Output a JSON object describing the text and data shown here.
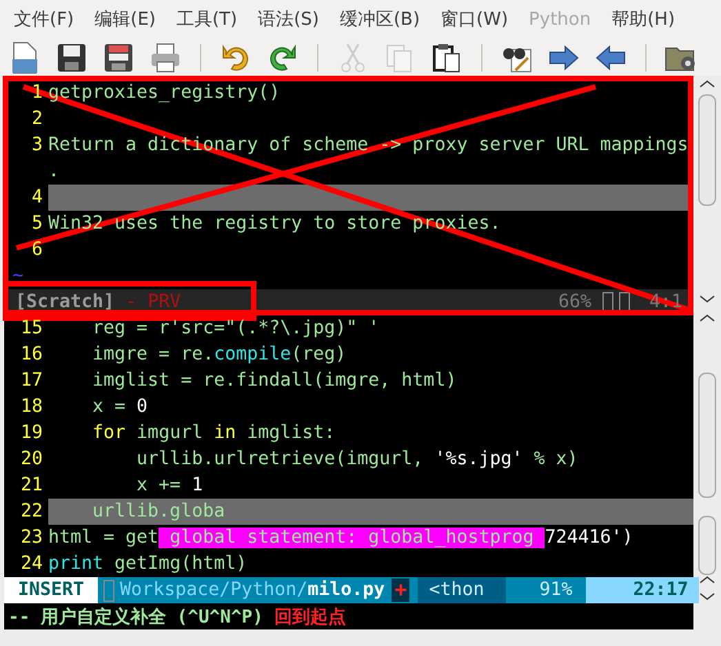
{
  "menu": [
    {
      "label": "文件(F)",
      "disabled": false
    },
    {
      "label": "编辑(E)",
      "disabled": false
    },
    {
      "label": "工具(T)",
      "disabled": false
    },
    {
      "label": "语法(S)",
      "disabled": false
    },
    {
      "label": "缓冲区(B)",
      "disabled": false
    },
    {
      "label": "窗口(W)",
      "disabled": false
    },
    {
      "label": "Python",
      "disabled": true
    },
    {
      "label": "帮助(H)",
      "disabled": false
    }
  ],
  "toolbar": [
    {
      "kind": "new",
      "disabled": false
    },
    {
      "kind": "save",
      "disabled": false
    },
    {
      "kind": "saveall",
      "disabled": false
    },
    {
      "kind": "print",
      "disabled": false
    },
    {
      "kind": "sep"
    },
    {
      "kind": "undo",
      "disabled": false
    },
    {
      "kind": "redo",
      "disabled": false
    },
    {
      "kind": "sep"
    },
    {
      "kind": "cut",
      "disabled": true
    },
    {
      "kind": "copy",
      "disabled": true
    },
    {
      "kind": "paste",
      "disabled": false
    },
    {
      "kind": "sep"
    },
    {
      "kind": "find",
      "disabled": false
    },
    {
      "kind": "forward",
      "disabled": false
    },
    {
      "kind": "back",
      "disabled": false
    },
    {
      "kind": "sep"
    },
    {
      "kind": "folder",
      "disabled": false
    }
  ],
  "preview": {
    "lines": [
      {
        "number": "1",
        "text": "getproxies_registry()",
        "current": false
      },
      {
        "number": "2",
        "current": false
      },
      {
        "number": "3",
        "text": "Return a dictionary of scheme -> proxy server URL mappings",
        "current": false
      },
      {
        "text": ".",
        "current": false
      },
      {
        "number": "4",
        "current": true
      },
      {
        "number": "5",
        "text": "Win32 uses the registry to store proxies.",
        "current": false
      },
      {
        "number": "6",
        "current": false
      }
    ],
    "filler": "~",
    "status": {
      "name": "[Scratch]",
      "flag": "- PRV",
      "percent": "66%",
      "position": "4:1"
    }
  },
  "code": {
    "lines": [
      {
        "number": "15",
        "current": false,
        "segments": [
          {
            "kind": "normal",
            "text": "    reg = r'src=\"(.*?\\.jpg)\" '"
          }
        ]
      },
      {
        "number": "16",
        "current": false,
        "segments": [
          {
            "kind": "normal",
            "text": "    imgre = re."
          },
          {
            "kind": "builtin",
            "text": "compile"
          },
          {
            "kind": "normal",
            "text": "(reg)"
          }
        ]
      },
      {
        "number": "17",
        "current": false,
        "segments": [
          {
            "kind": "normal",
            "text": "    imglist = re.findall(imgre, html)"
          }
        ]
      },
      {
        "number": "18",
        "current": false,
        "segments": [
          {
            "kind": "normal",
            "text": "    x = "
          },
          {
            "kind": "bright",
            "text": "0"
          }
        ]
      },
      {
        "number": "19",
        "current": false,
        "segments": [
          {
            "kind": "keyword",
            "text": "    for"
          },
          {
            "kind": "normal",
            "text": " imgurl "
          },
          {
            "kind": "keyword",
            "text": "in"
          },
          {
            "kind": "normal",
            "text": " imglist:"
          }
        ]
      },
      {
        "number": "20",
        "current": false,
        "segments": [
          {
            "kind": "normal",
            "text": "        urllib.urlretrieve(imgurl, "
          },
          {
            "kind": "bright",
            "text": "'%s.jpg'"
          },
          {
            "kind": "normal",
            "text": " % x)"
          }
        ]
      },
      {
        "number": "21",
        "current": false,
        "segments": [
          {
            "kind": "normal",
            "text": "        x += "
          },
          {
            "kind": "bright",
            "text": "1"
          }
        ]
      },
      {
        "number": "22",
        "current": true,
        "segments": [
          {
            "kind": "normal",
            "text": "    urllib.globa"
          }
        ]
      },
      {
        "number": "23",
        "current": false,
        "segments": [
          {
            "kind": "normal",
            "text": "html = get"
          },
          {
            "kind": "popup",
            "text": " global statement: global_hostprog "
          },
          {
            "kind": "bright",
            "text": "724416')"
          }
        ]
      },
      {
        "number": "24",
        "current": false,
        "segments": [
          {
            "kind": "builtin",
            "text": "print"
          },
          {
            "kind": "normal",
            "text": " getImg(html)"
          }
        ]
      }
    ]
  },
  "status": {
    "mode": "INSERT",
    "path": "Workspace/Python/",
    "file": "milo.py",
    "modified": "+",
    "filetype": "<thon",
    "percent": "91%",
    "position": "22:17"
  },
  "command": {
    "message": "-- 用户自定义补全 (^U^N^P)",
    "note": "回到起点"
  }
}
